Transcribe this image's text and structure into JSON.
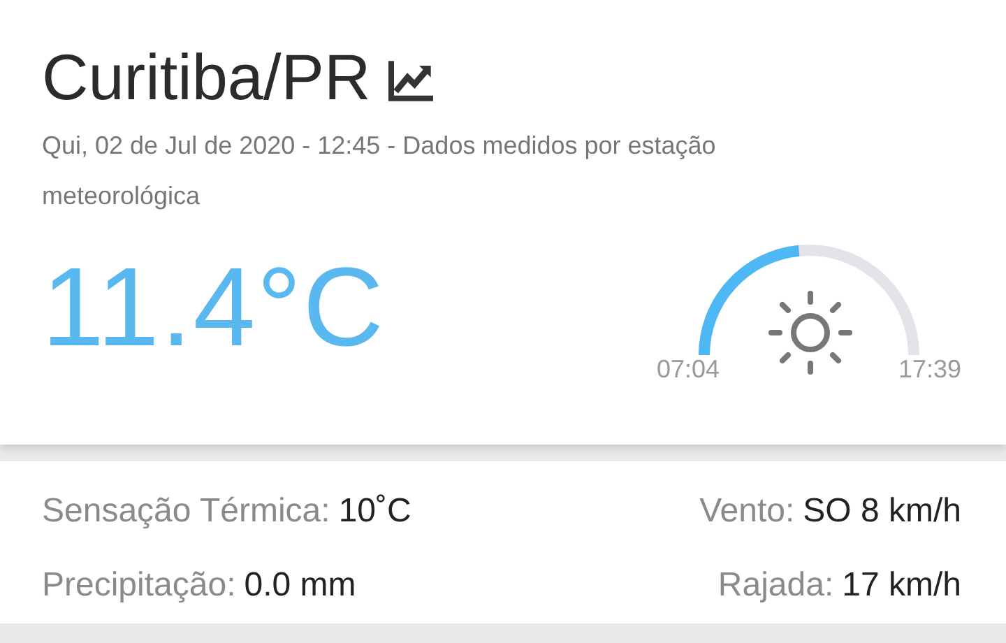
{
  "city": "Curitiba/PR",
  "subtitle": "Qui, 02 de Jul de 2020 - 12:45 - Dados medidos por estação meteorológica",
  "temperature": "11.4°C",
  "sun": {
    "sunrise": "07:04",
    "sunset": "17:39"
  },
  "details": [
    {
      "label": "Sensação Térmica:",
      "value": "10˚C"
    },
    {
      "label": "Vento:",
      "value": "SO 8 km/h"
    },
    {
      "label": "Precipitação:",
      "value": "0.0 mm"
    },
    {
      "label": "Rajada:",
      "value": "17 km/h"
    }
  ]
}
